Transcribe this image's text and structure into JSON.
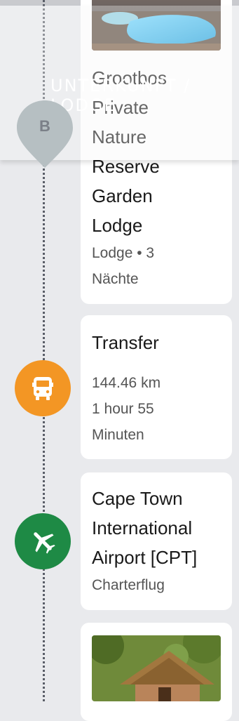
{
  "sticky_header": {
    "label": "UNTERKUNFT / LODGE"
  },
  "pin": {
    "letter": "B"
  },
  "lodge_card": {
    "title_lines": [
      "Grootbos",
      "Private",
      "Nature",
      "Reserve",
      "Garden",
      "Lodge"
    ],
    "subtitle_lines": [
      "Lodge • 3",
      "Nächte"
    ]
  },
  "transfer_card": {
    "title": "Transfer",
    "details": [
      "144.46 km",
      "1 hour 55",
      "Minuten"
    ],
    "icon": "bus-icon",
    "color": "#f39624"
  },
  "airport_card": {
    "title_lines": [
      "Cape Town",
      "International",
      "Airport [CPT]"
    ],
    "subtitle": "Charterflug",
    "icon": "airplane-icon",
    "color": "#1e8a45"
  },
  "next_card": {
    "image": "thatched-lodge-photo"
  }
}
